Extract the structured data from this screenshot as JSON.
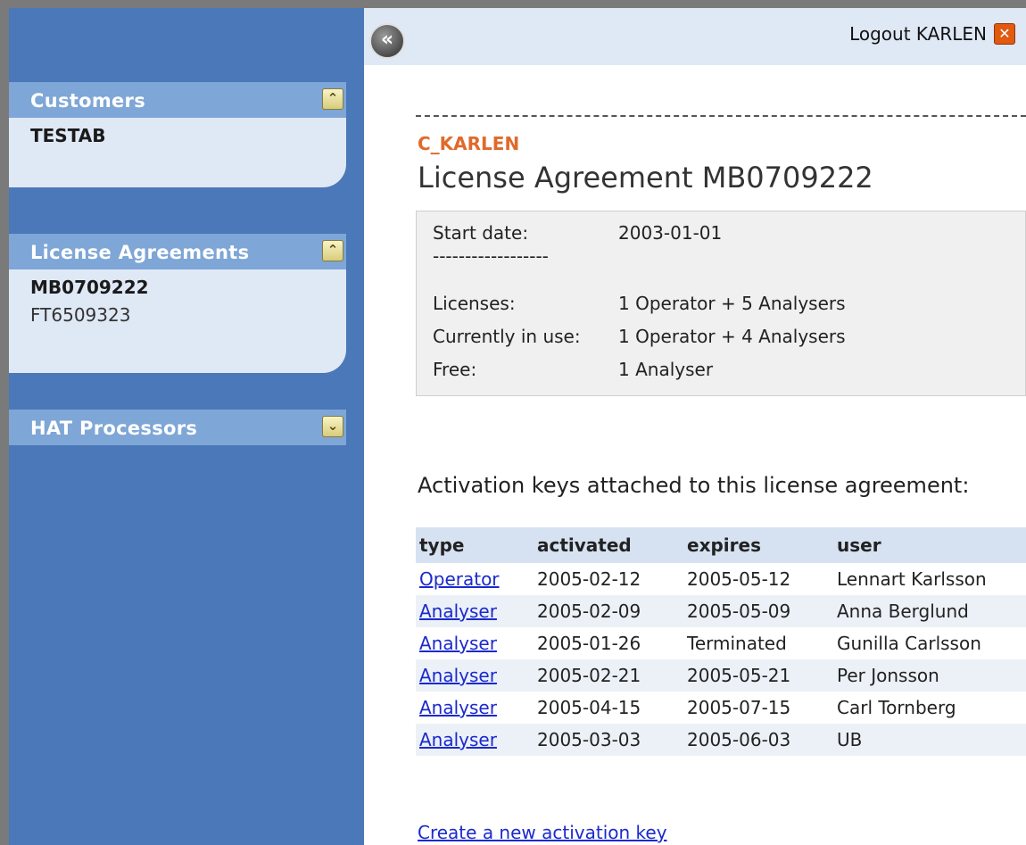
{
  "header": {
    "logout_label": "Logout KARLEN"
  },
  "sidebar": {
    "customers": {
      "title": "Customers",
      "items": [
        "TESTAB"
      ]
    },
    "license_agreements": {
      "title": "License Agreements",
      "items": [
        "MB0709222",
        "FT6509323"
      ]
    },
    "hat_processors": {
      "title": "HAT Processors"
    }
  },
  "main": {
    "user_code": "C_KARLEN",
    "title": "License Agreement MB0709222",
    "info": {
      "start_date_label": "Start date:",
      "start_date_value": "2003-01-01",
      "separator": "------------------",
      "licenses_label": "Licenses:",
      "licenses_value": "1 Operator + 5 Analysers",
      "in_use_label": "Currently in use:",
      "in_use_value": "1 Operator + 4 Analysers",
      "free_label": "Free:",
      "free_value": "1 Analyser"
    },
    "keys_heading": "Activation keys attached to this license agreement:",
    "table": {
      "headers": [
        "type",
        "activated",
        "expires",
        "user"
      ],
      "rows": [
        [
          "Operator",
          "2005-02-12",
          "2005-05-12",
          "Lennart Karlsson"
        ],
        [
          "Analyser",
          "2005-02-09",
          "2005-05-09",
          "Anna Berglund"
        ],
        [
          "Analyser",
          "2005-01-26",
          "Terminated",
          "Gunilla Carlsson"
        ],
        [
          "Analyser",
          "2005-02-21",
          "2005-05-21",
          "Per Jonsson"
        ],
        [
          "Analyser",
          "2005-04-15",
          "2005-07-15",
          "Carl Tornberg"
        ],
        [
          "Analyser",
          "2005-03-03",
          "2005-06-03",
          "UB"
        ]
      ]
    },
    "create_link": "Create a new activation key"
  },
  "icons": {
    "collapse": "double-chevron-left-icon",
    "logout": "close-icon",
    "panel_open": "double-chevron-up-icon",
    "panel_closed": "double-chevron-down-icon"
  }
}
